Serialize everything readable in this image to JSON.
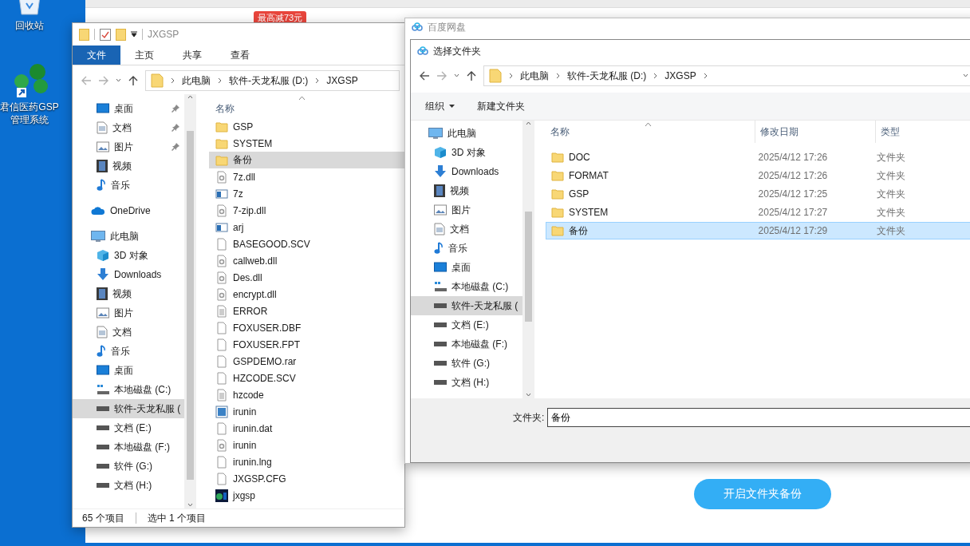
{
  "desktop_icons": [
    {
      "kind": "bin",
      "lines": [
        "回收站"
      ]
    },
    {
      "kind": "app",
      "lines": [
        "君信医药GSP",
        "管理系统"
      ]
    }
  ],
  "background_app": {
    "promo_badge": "最高减73元",
    "action_button": "开启文件夹备份"
  },
  "explorer": {
    "title": "JXGSP",
    "ribbon_tabs": [
      {
        "label": "文件",
        "selected": true
      },
      {
        "label": "主页",
        "selected": false
      },
      {
        "label": "共享",
        "selected": false
      },
      {
        "label": "查看",
        "selected": false
      }
    ],
    "address": [
      "此电脑",
      "软件-天龙私服 (D:)",
      "JXGSP"
    ],
    "nav": [
      {
        "children": [
          {
            "label": "桌面",
            "kind": "desktop",
            "pinned": true,
            "selected": false
          },
          {
            "label": "文档",
            "kind": "document",
            "pinned": true,
            "selected": false
          },
          {
            "label": "图片",
            "kind": "pictures",
            "pinned": true,
            "selected": false
          },
          {
            "label": "视频",
            "kind": "video",
            "pinned": false,
            "selected": false
          },
          {
            "label": "音乐",
            "kind": "music",
            "pinned": false,
            "selected": false
          }
        ]
      },
      {
        "label": "OneDrive",
        "kind": "cloud",
        "selected": false
      },
      {
        "label": "此电脑",
        "kind": "pc",
        "selected": false,
        "children": [
          {
            "label": "3D 对象",
            "kind": "objects",
            "selected": false
          },
          {
            "label": "Downloads",
            "kind": "downloads",
            "selected": false
          },
          {
            "label": "视频",
            "kind": "video",
            "selected": false
          },
          {
            "label": "图片",
            "kind": "pictures",
            "selected": false
          },
          {
            "label": "文档",
            "kind": "document",
            "selected": false
          },
          {
            "label": "音乐",
            "kind": "music",
            "selected": false
          },
          {
            "label": "桌面",
            "kind": "desktop",
            "selected": false
          },
          {
            "label": "本地磁盘 (C:)",
            "kind": "system-drive",
            "selected": false
          },
          {
            "label": "软件-天龙私服 (",
            "kind": "drive",
            "selected": true
          },
          {
            "label": "文档 (E:)",
            "kind": "drive",
            "selected": false
          },
          {
            "label": "本地磁盘 (F:)",
            "kind": "drive",
            "selected": false
          },
          {
            "label": "软件 (G:)",
            "kind": "drive",
            "selected": false
          },
          {
            "label": "文档 (H:)",
            "kind": "drive",
            "selected": false
          }
        ]
      }
    ],
    "column": "名称",
    "files": [
      {
        "name": "GSP",
        "kind": "folder",
        "selected": false
      },
      {
        "name": "SYSTEM",
        "kind": "folder",
        "selected": false
      },
      {
        "name": "备份",
        "kind": "folder",
        "selected": true
      },
      {
        "name": "7z.dll",
        "kind": "dll",
        "selected": false
      },
      {
        "name": "7z",
        "kind": "app",
        "selected": false
      },
      {
        "name": "7-zip.dll",
        "kind": "dll",
        "selected": false
      },
      {
        "name": "arj",
        "kind": "app",
        "selected": false
      },
      {
        "name": "BASEGOOD.SCV",
        "kind": "blank",
        "selected": false
      },
      {
        "name": "callweb.dll",
        "kind": "dll",
        "selected": false
      },
      {
        "name": "Des.dll",
        "kind": "dll",
        "selected": false
      },
      {
        "name": "encrypt.dll",
        "kind": "dll",
        "selected": false
      },
      {
        "name": "ERROR",
        "kind": "text",
        "selected": false
      },
      {
        "name": "FOXUSER.DBF",
        "kind": "blank",
        "selected": false
      },
      {
        "name": "FOXUSER.FPT",
        "kind": "blank",
        "selected": false
      },
      {
        "name": "GSPDEMO.rar",
        "kind": "blank",
        "selected": false
      },
      {
        "name": "HZCODE.SCV",
        "kind": "blank",
        "selected": false
      },
      {
        "name": "hzcode",
        "kind": "text",
        "selected": false
      },
      {
        "name": "irunin",
        "kind": "image",
        "selected": false
      },
      {
        "name": "irunin.dat",
        "kind": "blank",
        "selected": false
      },
      {
        "name": "irunin",
        "kind": "settings",
        "selected": false
      },
      {
        "name": "irunin.lng",
        "kind": "blank",
        "selected": false
      },
      {
        "name": "JXGSP.CFG",
        "kind": "blank",
        "selected": false
      },
      {
        "name": "jxgsp",
        "kind": "program",
        "selected": false
      }
    ],
    "status": [
      "65 个项目",
      "选中 1 个项目"
    ]
  },
  "dialog": {
    "app_title": "百度网盘",
    "title": "选择文件夹",
    "address": [
      "此电脑",
      "软件-天龙私服 (D:)",
      "JXGSP"
    ],
    "toolbar": [
      {
        "label": "组织",
        "kind": "menu"
      },
      {
        "label": "新建文件夹",
        "kind": "plain"
      }
    ],
    "tree": [
      {
        "label": "此电脑",
        "kind": "pc",
        "selected": false,
        "children": [
          {
            "label": "3D 对象",
            "kind": "objects",
            "selected": false
          },
          {
            "label": "Downloads",
            "kind": "downloads",
            "selected": false
          },
          {
            "label": "视频",
            "kind": "video",
            "selected": false
          },
          {
            "label": "图片",
            "kind": "pictures",
            "selected": false
          },
          {
            "label": "文档",
            "kind": "document",
            "selected": false
          },
          {
            "label": "音乐",
            "kind": "music",
            "selected": false
          },
          {
            "label": "桌面",
            "kind": "desktop",
            "selected": false
          },
          {
            "label": "本地磁盘 (C:)",
            "kind": "system-drive",
            "selected": false
          },
          {
            "label": "软件-天龙私服 (",
            "kind": "drive",
            "selected": true
          },
          {
            "label": "文档 (E:)",
            "kind": "drive",
            "selected": false
          },
          {
            "label": "本地磁盘 (F:)",
            "kind": "drive",
            "selected": false
          },
          {
            "label": "软件 (G:)",
            "kind": "drive",
            "selected": false
          },
          {
            "label": "文档 (H:)",
            "kind": "drive",
            "selected": false
          }
        ]
      }
    ],
    "columns": [
      "名称",
      "修改日期",
      "类型"
    ],
    "rows": [
      {
        "name": "DOC",
        "date": "2025/4/12 17:26",
        "type": "文件夹",
        "selected": false
      },
      {
        "name": "FORMAT",
        "date": "2025/4/12 17:26",
        "type": "文件夹",
        "selected": false
      },
      {
        "name": "GSP",
        "date": "2025/4/12 17:25",
        "type": "文件夹",
        "selected": false
      },
      {
        "name": "SYSTEM",
        "date": "2025/4/12 17:27",
        "type": "文件夹",
        "selected": false
      },
      {
        "name": "备份",
        "date": "2025/4/12 17:29",
        "type": "文件夹",
        "selected": true
      }
    ],
    "folder_label": "文件夹:",
    "folder_value": "备份"
  }
}
